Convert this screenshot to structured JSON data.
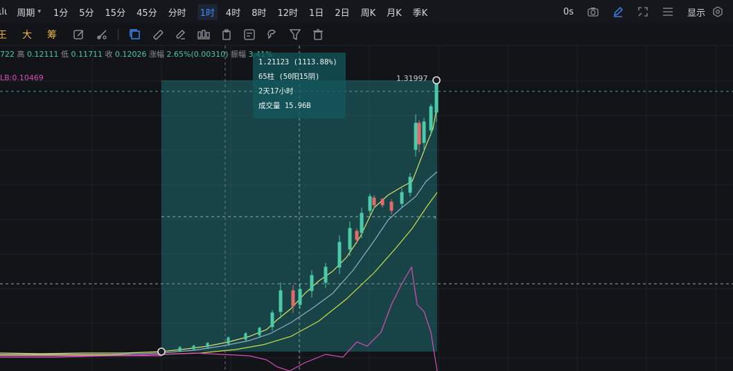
{
  "toolbar": {
    "leading_fragment": "ιlι",
    "period_label": "周期",
    "intervals": [
      {
        "label": "1分",
        "active": false
      },
      {
        "label": "5分",
        "active": false
      },
      {
        "label": "15分",
        "active": false
      },
      {
        "label": "45分",
        "active": false
      },
      {
        "label": "分时",
        "active": false
      },
      {
        "label": "1时",
        "active": true
      },
      {
        "label": "4时",
        "active": false
      },
      {
        "label": "8时",
        "active": false
      },
      {
        "label": "12时",
        "active": false
      },
      {
        "label": "1日",
        "active": false
      },
      {
        "label": "2日",
        "active": false
      },
      {
        "label": "周K",
        "active": false
      },
      {
        "label": "月K",
        "active": false
      },
      {
        "label": "季K",
        "active": false
      }
    ],
    "countdown": "0s",
    "display_label": "显示"
  },
  "drawing_toolbar": {
    "chinese_labels": [
      "王",
      "大",
      "筹"
    ]
  },
  "ohlc": {
    "open_fragment": "722",
    "high_label": "高",
    "high": "0.12111",
    "low_label": "低",
    "low": "0.11711",
    "close_label": "收",
    "close": "0.12026",
    "change_label": "涨幅",
    "change": "2.65%(0.00310)",
    "amplitude_label": "振幅",
    "amplitude": "3.41%"
  },
  "indicator_label": "LB:0.10469",
  "measure_tooltip": {
    "line1": "1.21123 (1113.88%)",
    "line2": "65柱 (50阳15阴)",
    "line3": "2天17小时",
    "line4": "成交量 15.96B"
  },
  "price_marker": "1.31997",
  "colors": {
    "up": "#4cc9a6",
    "down": "#e06b6b",
    "accent": "#3d8cff",
    "ma_fast": "#d9e36a",
    "ma_mid": "#8fb0c8",
    "ma_slow": "#c9e04a",
    "indicator": "#d64fb6",
    "measure_fill": "#1f6c70"
  }
}
